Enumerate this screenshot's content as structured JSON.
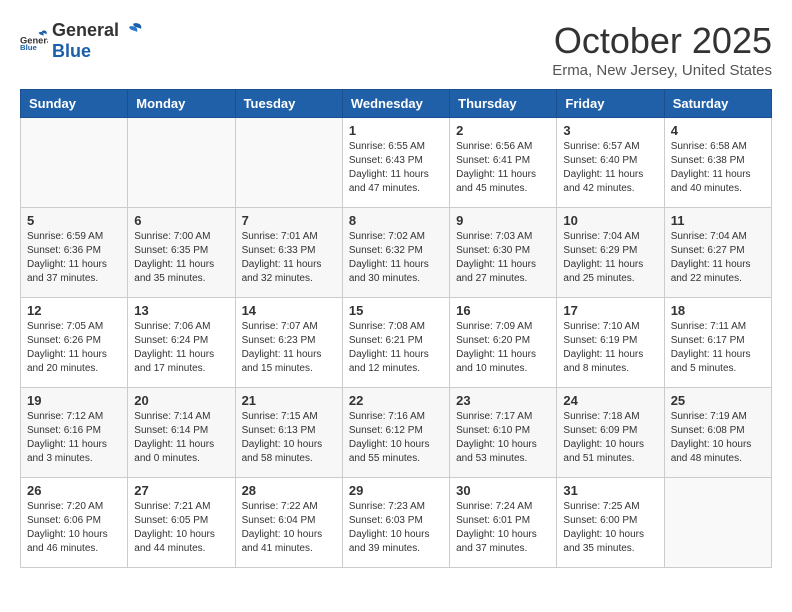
{
  "header": {
    "logo_general": "General",
    "logo_blue": "Blue",
    "month_title": "October 2025",
    "location": "Erma, New Jersey, United States"
  },
  "calendar": {
    "days_of_week": [
      "Sunday",
      "Monday",
      "Tuesday",
      "Wednesday",
      "Thursday",
      "Friday",
      "Saturday"
    ],
    "weeks": [
      [
        {
          "day": "",
          "info": ""
        },
        {
          "day": "",
          "info": ""
        },
        {
          "day": "",
          "info": ""
        },
        {
          "day": "1",
          "info": "Sunrise: 6:55 AM\nSunset: 6:43 PM\nDaylight: 11 hours\nand 47 minutes."
        },
        {
          "day": "2",
          "info": "Sunrise: 6:56 AM\nSunset: 6:41 PM\nDaylight: 11 hours\nand 45 minutes."
        },
        {
          "day": "3",
          "info": "Sunrise: 6:57 AM\nSunset: 6:40 PM\nDaylight: 11 hours\nand 42 minutes."
        },
        {
          "day": "4",
          "info": "Sunrise: 6:58 AM\nSunset: 6:38 PM\nDaylight: 11 hours\nand 40 minutes."
        }
      ],
      [
        {
          "day": "5",
          "info": "Sunrise: 6:59 AM\nSunset: 6:36 PM\nDaylight: 11 hours\nand 37 minutes."
        },
        {
          "day": "6",
          "info": "Sunrise: 7:00 AM\nSunset: 6:35 PM\nDaylight: 11 hours\nand 35 minutes."
        },
        {
          "day": "7",
          "info": "Sunrise: 7:01 AM\nSunset: 6:33 PM\nDaylight: 11 hours\nand 32 minutes."
        },
        {
          "day": "8",
          "info": "Sunrise: 7:02 AM\nSunset: 6:32 PM\nDaylight: 11 hours\nand 30 minutes."
        },
        {
          "day": "9",
          "info": "Sunrise: 7:03 AM\nSunset: 6:30 PM\nDaylight: 11 hours\nand 27 minutes."
        },
        {
          "day": "10",
          "info": "Sunrise: 7:04 AM\nSunset: 6:29 PM\nDaylight: 11 hours\nand 25 minutes."
        },
        {
          "day": "11",
          "info": "Sunrise: 7:04 AM\nSunset: 6:27 PM\nDaylight: 11 hours\nand 22 minutes."
        }
      ],
      [
        {
          "day": "12",
          "info": "Sunrise: 7:05 AM\nSunset: 6:26 PM\nDaylight: 11 hours\nand 20 minutes."
        },
        {
          "day": "13",
          "info": "Sunrise: 7:06 AM\nSunset: 6:24 PM\nDaylight: 11 hours\nand 17 minutes."
        },
        {
          "day": "14",
          "info": "Sunrise: 7:07 AM\nSunset: 6:23 PM\nDaylight: 11 hours\nand 15 minutes."
        },
        {
          "day": "15",
          "info": "Sunrise: 7:08 AM\nSunset: 6:21 PM\nDaylight: 11 hours\nand 12 minutes."
        },
        {
          "day": "16",
          "info": "Sunrise: 7:09 AM\nSunset: 6:20 PM\nDaylight: 11 hours\nand 10 minutes."
        },
        {
          "day": "17",
          "info": "Sunrise: 7:10 AM\nSunset: 6:19 PM\nDaylight: 11 hours\nand 8 minutes."
        },
        {
          "day": "18",
          "info": "Sunrise: 7:11 AM\nSunset: 6:17 PM\nDaylight: 11 hours\nand 5 minutes."
        }
      ],
      [
        {
          "day": "19",
          "info": "Sunrise: 7:12 AM\nSunset: 6:16 PM\nDaylight: 11 hours\nand 3 minutes."
        },
        {
          "day": "20",
          "info": "Sunrise: 7:14 AM\nSunset: 6:14 PM\nDaylight: 11 hours\nand 0 minutes."
        },
        {
          "day": "21",
          "info": "Sunrise: 7:15 AM\nSunset: 6:13 PM\nDaylight: 10 hours\nand 58 minutes."
        },
        {
          "day": "22",
          "info": "Sunrise: 7:16 AM\nSunset: 6:12 PM\nDaylight: 10 hours\nand 55 minutes."
        },
        {
          "day": "23",
          "info": "Sunrise: 7:17 AM\nSunset: 6:10 PM\nDaylight: 10 hours\nand 53 minutes."
        },
        {
          "day": "24",
          "info": "Sunrise: 7:18 AM\nSunset: 6:09 PM\nDaylight: 10 hours\nand 51 minutes."
        },
        {
          "day": "25",
          "info": "Sunrise: 7:19 AM\nSunset: 6:08 PM\nDaylight: 10 hours\nand 48 minutes."
        }
      ],
      [
        {
          "day": "26",
          "info": "Sunrise: 7:20 AM\nSunset: 6:06 PM\nDaylight: 10 hours\nand 46 minutes."
        },
        {
          "day": "27",
          "info": "Sunrise: 7:21 AM\nSunset: 6:05 PM\nDaylight: 10 hours\nand 44 minutes."
        },
        {
          "day": "28",
          "info": "Sunrise: 7:22 AM\nSunset: 6:04 PM\nDaylight: 10 hours\nand 41 minutes."
        },
        {
          "day": "29",
          "info": "Sunrise: 7:23 AM\nSunset: 6:03 PM\nDaylight: 10 hours\nand 39 minutes."
        },
        {
          "day": "30",
          "info": "Sunrise: 7:24 AM\nSunset: 6:01 PM\nDaylight: 10 hours\nand 37 minutes."
        },
        {
          "day": "31",
          "info": "Sunrise: 7:25 AM\nSunset: 6:00 PM\nDaylight: 10 hours\nand 35 minutes."
        },
        {
          "day": "",
          "info": ""
        }
      ]
    ]
  }
}
